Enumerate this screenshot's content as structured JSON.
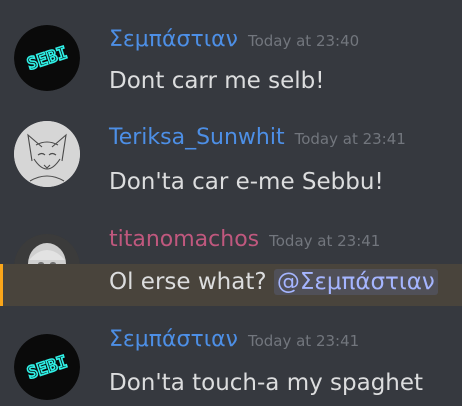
{
  "colors": {
    "background": "#36393f",
    "mention_highlight": "#49443c",
    "mention_text": "#a5b5ff",
    "username_blue": "#4d8fe6",
    "username_pink": "#c0587e",
    "timestamp": "#72767d",
    "message_text": "#dcddde"
  },
  "messages": [
    {
      "username": "Σεμπάστιαν",
      "username_color": "#4d8fe6",
      "timestamp": "Today at 23:40",
      "text": "Dont carr me selb!",
      "avatar": "sebi-neon-logo",
      "avatar_text": "SEBI"
    },
    {
      "username": "Teriksa_Sunwhit",
      "username_color": "#4d8fe6",
      "timestamp": "Today at 23:41",
      "text": "Don'ta car e-me Sebbu!",
      "avatar": "fox-sketch-avatar"
    },
    {
      "username": "titanomachos",
      "username_color": "#c0587e",
      "timestamp": "Today at 23:41",
      "text": "Ol erse what? ",
      "mention": "@Σεμπάστιαν",
      "avatar": "marble-bust-avatar"
    },
    {
      "username": "Σεμπάστιαν",
      "username_color": "#4d8fe6",
      "timestamp": "Today at 23:41",
      "text": "Don'ta touch-a my spaghet",
      "avatar": "sebi-neon-logo",
      "avatar_text": "SEBI"
    }
  ]
}
